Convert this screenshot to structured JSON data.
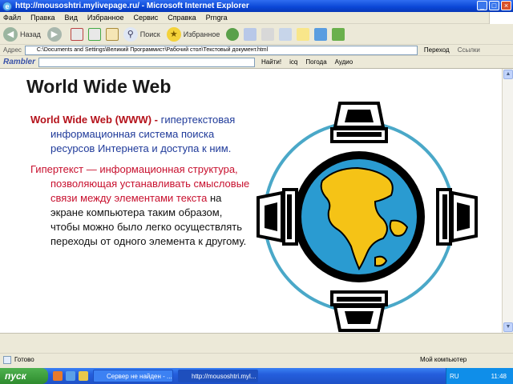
{
  "window": {
    "title": "http://mousoshtri.mylivepage.ru/ - Microsoft Internet Explorer"
  },
  "menu": [
    "Файл",
    "Правка",
    "Вид",
    "Избранное",
    "Сервис",
    "Справка",
    "Prngra"
  ],
  "toolbar": {
    "back_label": "Назад",
    "search_label": "Поиск",
    "favorites_label": "Избранное"
  },
  "address": {
    "label": "Адрес",
    "value": "C:\\Documents and Settings\\Великий Программист\\Рабочий стол\\Текстовый документ.html",
    "go_label": "Переход",
    "links_label": "Ссылки"
  },
  "rambler": {
    "logo": "Rambler",
    "find_label": "Найти!",
    "icq_label": "icq",
    "weather_label": "Погода",
    "audio_label": "Аудио"
  },
  "page": {
    "title": "World Wide Web",
    "para1_term": "World Wide Web (WWW) -",
    "para1_rest": "гипертекстовая информационная система поиска ресурсов Интернета и доступа к ним.",
    "para2_red": "Гипертекст — информационная структура, позволяющая устанавливать смысловые связи между элементами текста",
    "para2_black": "на экране компьютера таким образом, чтобы можно было легко осуществлять переходы от одного элемента к другому."
  },
  "status": {
    "ready": "Готово",
    "zone": "Мой компьютер"
  },
  "taskbar": {
    "start": "пуск",
    "task1": "Сервер не найден - ...",
    "task2": "http://mousoshtri.myl...",
    "lang": "RU",
    "clock": "11:48"
  },
  "colors": {
    "term": "#b5121b",
    "hypertext_red": "#c8102e",
    "globe_ocean": "#2a9bd1",
    "globe_land": "#f5c316",
    "ring": "#4aa8c8"
  }
}
